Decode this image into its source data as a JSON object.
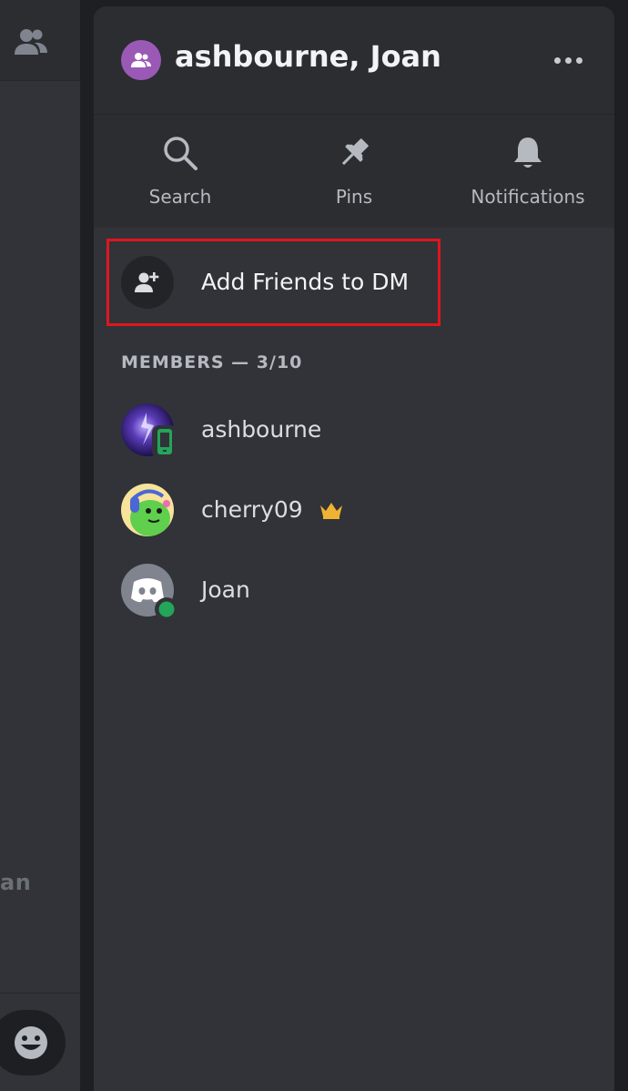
{
  "left_pane": {
    "partial_text": "an",
    "icons": [
      "members-icon",
      "emoji-icon"
    ]
  },
  "header": {
    "title": "ashbourne, Joan",
    "group_icon": "group-dm-icon",
    "more_icon": "more-horizontal-icon"
  },
  "toolbar": {
    "items": [
      {
        "label": "Search",
        "icon": "search-icon"
      },
      {
        "label": "Pins",
        "icon": "pin-icon"
      },
      {
        "label": "Notifications",
        "icon": "bell-icon"
      }
    ]
  },
  "add_friends": {
    "label": "Add Friends to DM",
    "icon": "add-user-icon"
  },
  "members": {
    "header": "MEMBERS — 3/10",
    "list": [
      {
        "name": "ashbourne",
        "status": "mobile"
      },
      {
        "name": "cherry09",
        "badge": "crown-icon"
      },
      {
        "name": "Joan",
        "status": "online"
      }
    ]
  },
  "colors": {
    "accent_red": "#e0161e",
    "group_purple": "#9b59b6",
    "online_green": "#23a55a",
    "crown_gold": "#f0b232"
  }
}
